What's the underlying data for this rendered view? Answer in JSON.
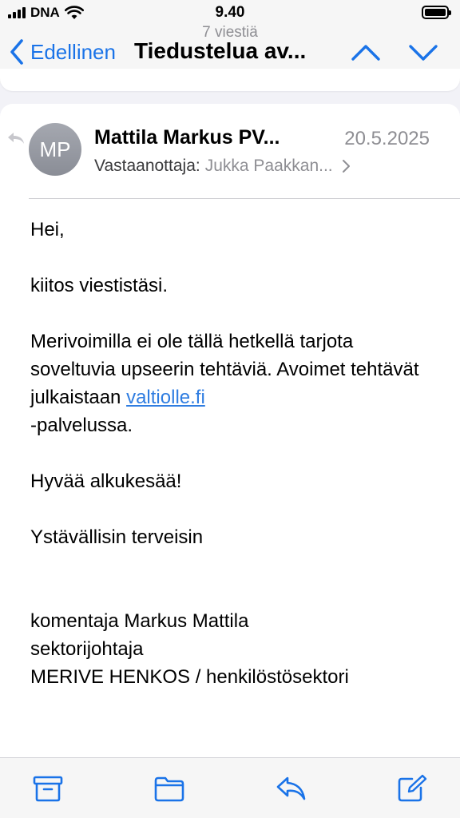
{
  "status_bar": {
    "carrier": "DNA",
    "time": "9.40"
  },
  "nav": {
    "message_count": "7 viestiä",
    "back_label": "Edellinen",
    "title": "Tiedustelua av..."
  },
  "message": {
    "avatar_initials": "MP",
    "sender": "Mattila Markus PV...",
    "date": "20.5.2025",
    "recipient_label": "Vastaanottaja:",
    "recipient_value": "Jukka Paakkan...",
    "greeting": "Hei,",
    "thanks": "kiitos viestistäsi.",
    "para_before_link": "Merivoimilla ei ole tällä hetkellä tarjota soveltuvia upseerin tehtäviä. Avoimet tehtävät julkaistaan ",
    "link_text": "valtiolle.fi",
    "para_after_link": "-palvelussa.",
    "wish": "Hyvää alkukesää!",
    "closing": "Ystävällisin terveisin",
    "signature_name": "komentaja Markus Mattila",
    "signature_title": "sektorijohtaja",
    "signature_unit": "MERIVE HENKOS / henkilöstösektori"
  },
  "toolbar": {
    "icons": [
      "archive-icon",
      "folder-icon",
      "reply-icon",
      "compose-icon"
    ]
  },
  "colors": {
    "accent": "#1a73e8",
    "link": "#2f7de1",
    "secondary_text": "#8e8e93",
    "background": "#f2f2f7"
  }
}
